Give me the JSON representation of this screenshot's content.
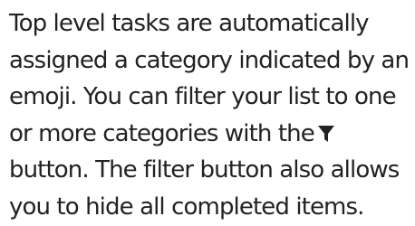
{
  "help": {
    "line1": "Top level tasks are automatically",
    "line2": "assigned a category indicated by an",
    "line3": "emoji. You can filter your list to one",
    "line4": "or more categories with the",
    "line5": "button. The filter button also allows",
    "line6": "you to hide all completed items."
  },
  "icons": {
    "filter": "filter-funnel-icon"
  },
  "colors": {
    "text": "#222222",
    "icon": "#222222",
    "background": "#ffffff"
  }
}
